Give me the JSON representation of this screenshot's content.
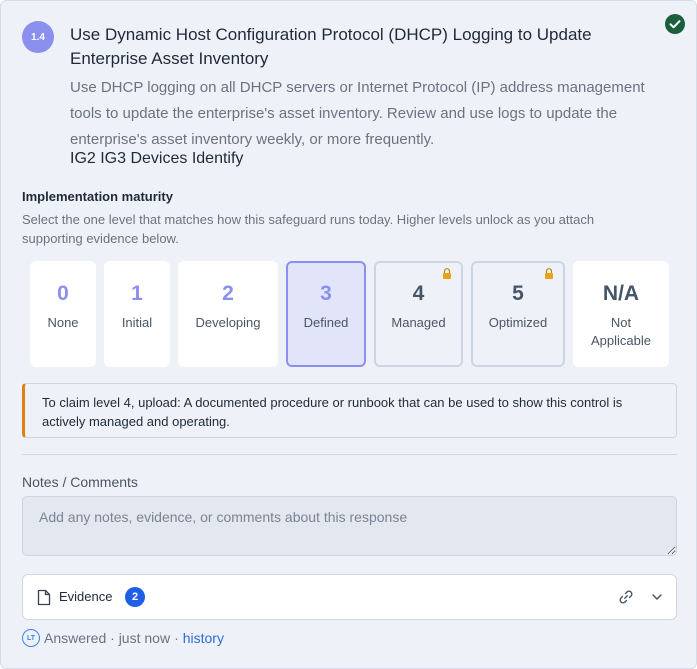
{
  "safeguard": {
    "id": "1.4",
    "title": "Use Dynamic Host Configuration Protocol (DHCP) Logging to Update Enterprise Asset Inventory",
    "description": "Use DHCP logging on all DHCP servers or Internet Protocol (IP) address management tools to update the enterprise's asset inventory. Review and use logs to update the enterprise's asset inventory weekly, or more frequently.",
    "tags": "IG2 IG3 Devices Identify",
    "status_icon": "check-circle-icon"
  },
  "implementation": {
    "heading": "Implementation maturity",
    "help": "Select the one level that matches how this safeguard runs today. Higher levels unlock as you attach supporting evidence below.",
    "selected_level": "3",
    "levels": [
      {
        "value": "0",
        "label": "None",
        "state": "normal"
      },
      {
        "value": "1",
        "label": "Initial",
        "state": "normal"
      },
      {
        "value": "2",
        "label": "Developing",
        "state": "normal"
      },
      {
        "value": "3",
        "label": "Defined",
        "state": "selected"
      },
      {
        "value": "4",
        "label": "Managed",
        "state": "locked"
      },
      {
        "value": "5",
        "label": "Optimized",
        "state": "locked"
      },
      {
        "value": "N/A",
        "label": "Not Applicable",
        "state": "normal"
      }
    ]
  },
  "callout": {
    "text": "To claim level 4, upload: A documented procedure or runbook that can be used to show this control is actively managed and operating.",
    "accent": "#e07f12"
  },
  "notes": {
    "label": "Notes / Comments",
    "placeholder": "Add any notes, evidence, or comments about this response",
    "value": ""
  },
  "evidence": {
    "label": "Evidence",
    "count": "2",
    "icons": [
      "document-icon",
      "link-icon",
      "chevron-down-icon"
    ]
  },
  "footer": {
    "avatar_initials": "LT",
    "status": "Answered · just now",
    "history_link": "history"
  },
  "colors": {
    "accent": "#8b90ee",
    "success": "#1b5e3b",
    "link": "#2f6bd8",
    "badge": "#1f5fe8"
  }
}
